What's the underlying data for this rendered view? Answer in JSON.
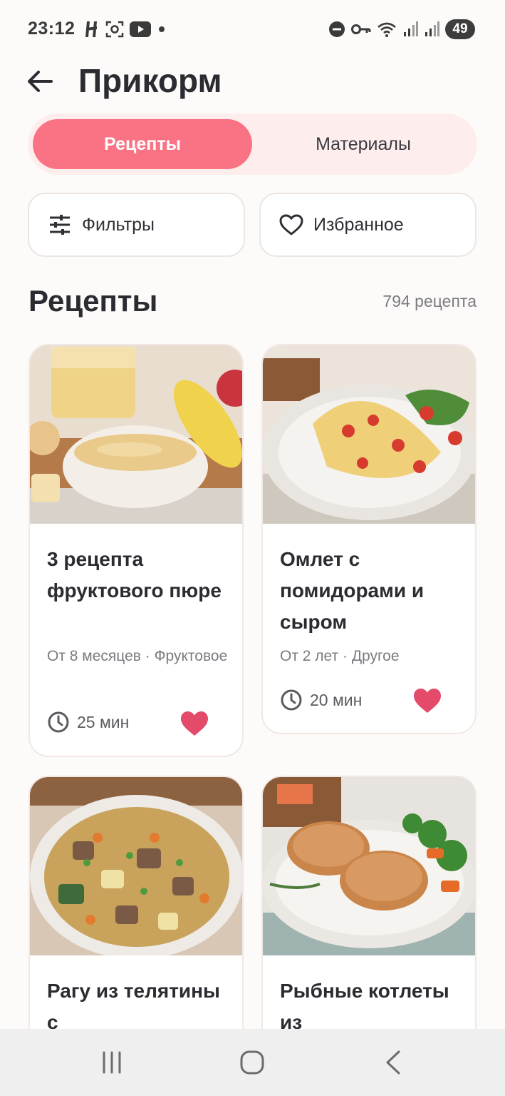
{
  "status_bar": {
    "time": "23:12",
    "battery": "49",
    "left_icons": [
      "app-logo-icon",
      "screen-capture-icon",
      "youtube-icon",
      "dot-icon"
    ],
    "right_icons": [
      "do-not-disturb-icon",
      "vpn-key-icon",
      "wifi-icon",
      "signal-icon",
      "signal-icon"
    ]
  },
  "header": {
    "title": "Прикорм",
    "back_icon": "arrow-left-icon"
  },
  "tabs": [
    {
      "label": "Рецепты",
      "active": true
    },
    {
      "label": "Материалы",
      "active": false
    }
  ],
  "actions": {
    "filters_label": "Фильтры",
    "favorites_label": "Избранное"
  },
  "section": {
    "title": "Рецепты",
    "count": "794 рецепта"
  },
  "colors": {
    "accent": "#f97385",
    "heart": "#e44a6a",
    "segment_bg": "#fdeeed"
  },
  "recipes": [
    {
      "title": "3 рецепта фруктового пюре",
      "meta": "От 8 месяцев · Фруктовое",
      "time": "25 мин",
      "favorite": true,
      "image": "apple-puree-bowl"
    },
    {
      "title": "Омлет с помидорами и сыром",
      "meta": "От 2 лет · Другое",
      "time": "20 мин",
      "favorite": true,
      "image": "omelette-plate"
    },
    {
      "title": "Рагу из телятины с",
      "image": "veal-stew-bowl"
    },
    {
      "title": "Рыбные котлеты из",
      "image": "fish-cutlets-plate"
    }
  ],
  "nav_bar": {
    "buttons": [
      "recent-apps-icon",
      "home-icon",
      "back-icon"
    ]
  }
}
